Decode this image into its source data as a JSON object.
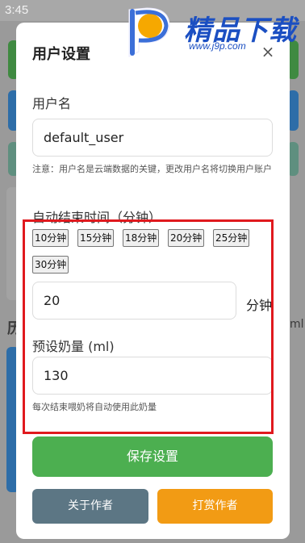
{
  "status_bar": {
    "time": "3:45"
  },
  "watermark": {
    "text": "精品下载",
    "url": "www.j9p.com"
  },
  "background": {
    "side_label": "历",
    "right_label": "ml"
  },
  "dialog": {
    "title": "用户设置",
    "close_symbol": "×",
    "username": {
      "label": "用户名",
      "value": "default_user",
      "hint": "注意：用户名是云端数据的关键，更改用户名将切换用户账户"
    },
    "auto_end": {
      "label": "自动结束时间（分钟）",
      "presets": [
        "10分钟",
        "15分钟",
        "18分钟",
        "20分钟",
        "25分钟",
        "30分钟"
      ],
      "value": "20",
      "unit": "分钟"
    },
    "milk": {
      "label": "预设奶量 (ml)",
      "value": "130",
      "hint": "每次结束喂奶将自动使用此奶量"
    },
    "buttons": {
      "save": "保存设置",
      "about": "关于作者",
      "tip": "打赏作者"
    }
  },
  "colors": {
    "save_button": "#4caf50",
    "about_button": "#5c7684",
    "tip_button": "#f29b14",
    "highlight_border": "#e0191e",
    "watermark": "#1b4fc2"
  }
}
